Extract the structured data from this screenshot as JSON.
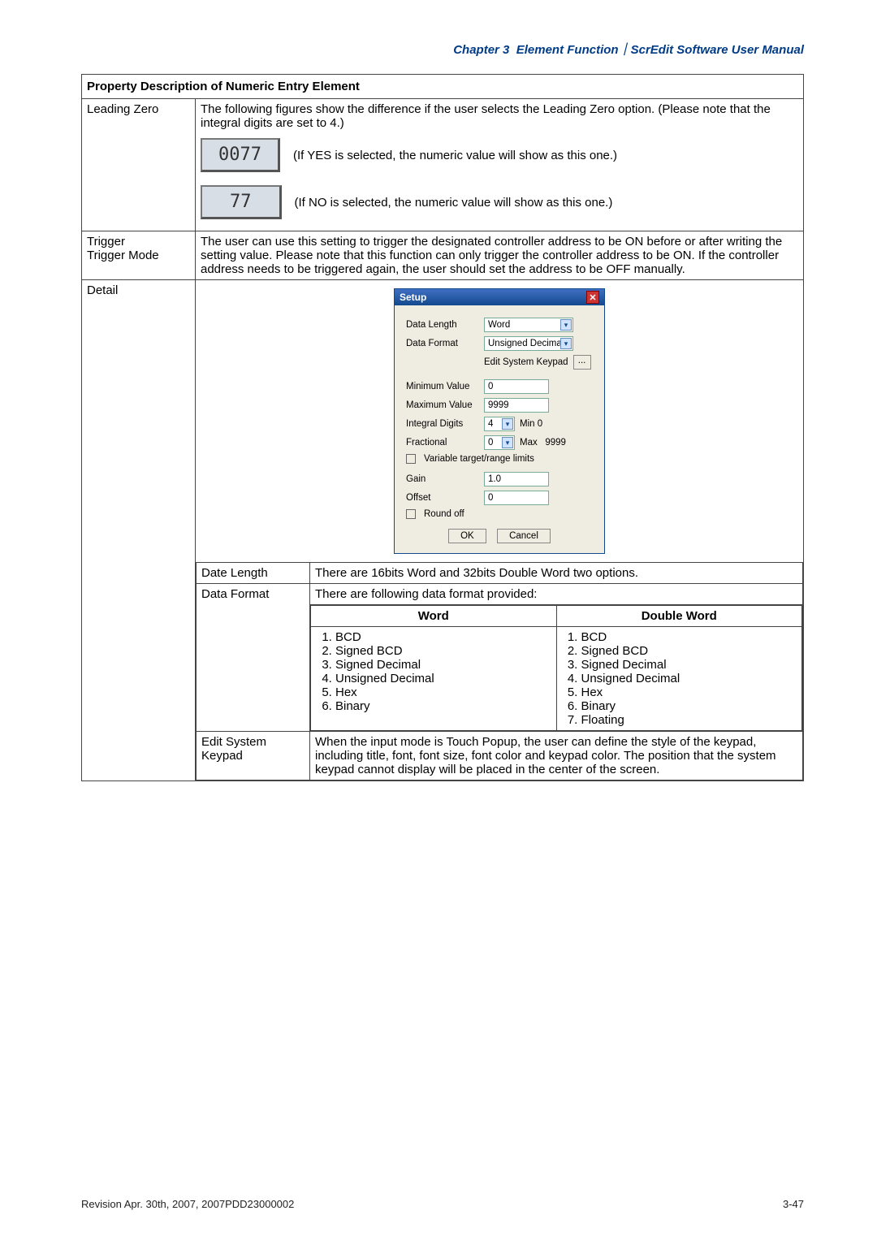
{
  "header": {
    "chapter": "Chapter 3",
    "section": "Element Function",
    "manual": "ScrEdit Software User Manual"
  },
  "table_title": "Property Description of Numeric Entry Element",
  "rows": {
    "leading_zero": {
      "label": "Leading Zero",
      "desc": "The following figures show the difference if the user selects the Leading Zero option. (Please note that the integral digits are set to 4.)",
      "yes_display": "0077",
      "yes_note": "(If YES is selected, the numeric value will show as this one.)",
      "no_display": "77",
      "no_note": "(If NO is selected, the numeric value will show as this one.)"
    },
    "trigger": {
      "label": "Trigger\nTrigger Mode",
      "desc": "The user can use this setting to trigger the designated controller address to be ON before or after writing the setting value. Please note that this function can only trigger the controller address to be ON. If the controller address needs to be triggered again, the user should set the address to be OFF manually."
    },
    "detail": {
      "label": "Detail",
      "dialog": {
        "title": "Setup",
        "data_length": {
          "label": "Data Length",
          "value": "Word"
        },
        "data_format": {
          "label": "Data Format",
          "value": "Unsigned Decimal"
        },
        "edit_keypad": {
          "label": "Edit System Keypad",
          "btn": "..."
        },
        "min": {
          "label": "Minimum Value",
          "value": "0"
        },
        "max": {
          "label": "Maximum Value",
          "value": "9999"
        },
        "integral": {
          "label": "Integral Digits",
          "value": "4",
          "min_label": "Min",
          "min_val": "0"
        },
        "fractional": {
          "label": "Fractional",
          "value": "0",
          "max_label": "Max",
          "max_val": "9999"
        },
        "variable": "Variable target/range limits",
        "gain": {
          "label": "Gain",
          "value": "1.0"
        },
        "offset": {
          "label": "Offset",
          "value": "0"
        },
        "round": "Round off",
        "ok": "OK",
        "cancel": "Cancel"
      },
      "sub": {
        "date_length": {
          "label": "Date Length",
          "desc": "There are 16bits Word and 32bits Double Word two options."
        },
        "data_format": {
          "label": "Data Format",
          "intro": "There are following data format provided:",
          "word_col": "Word",
          "dword_col": "Double Word",
          "word": [
            "BCD",
            "Signed BCD",
            "Signed Decimal",
            "Unsigned Decimal",
            "Hex",
            "Binary"
          ],
          "dword": [
            "BCD",
            "Signed BCD",
            "Signed Decimal",
            "Unsigned Decimal",
            "Hex",
            "Binary",
            "Floating"
          ]
        },
        "edit_keypad": {
          "label": "Edit System Keypad",
          "desc": "When the input mode is Touch Popup, the user can define the style of the keypad, including title, font, font size, font color and keypad color. The position that the system keypad cannot display will be placed in the center of the screen."
        }
      }
    }
  },
  "footer_left": "Revision Apr. 30th, 2007, 2007PDD23000002",
  "footer_right": "3-47"
}
